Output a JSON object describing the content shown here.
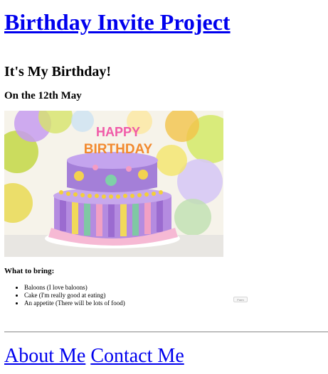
{
  "header": {
    "title_link": "Birthday Invite Project"
  },
  "main": {
    "heading": "It's My Birthday!",
    "subheading": "On the 12th May",
    "image": {
      "topper_line1": "HAPPY",
      "topper_line2": "BIRTHDAY"
    },
    "bring_heading": "What to bring:",
    "bring_items": [
      "Baloons (I love baloons)",
      "Cake (I'm really good at eating)",
      "An appetite (There will be lots of food)"
    ],
    "form_button_label": "Form"
  },
  "footer": {
    "links": [
      "About Me",
      "Contact Me"
    ]
  },
  "colors": {
    "link": "#0000ee",
    "cake_purple": "#b99be0",
    "cake_pink": "#f4b8d2"
  }
}
